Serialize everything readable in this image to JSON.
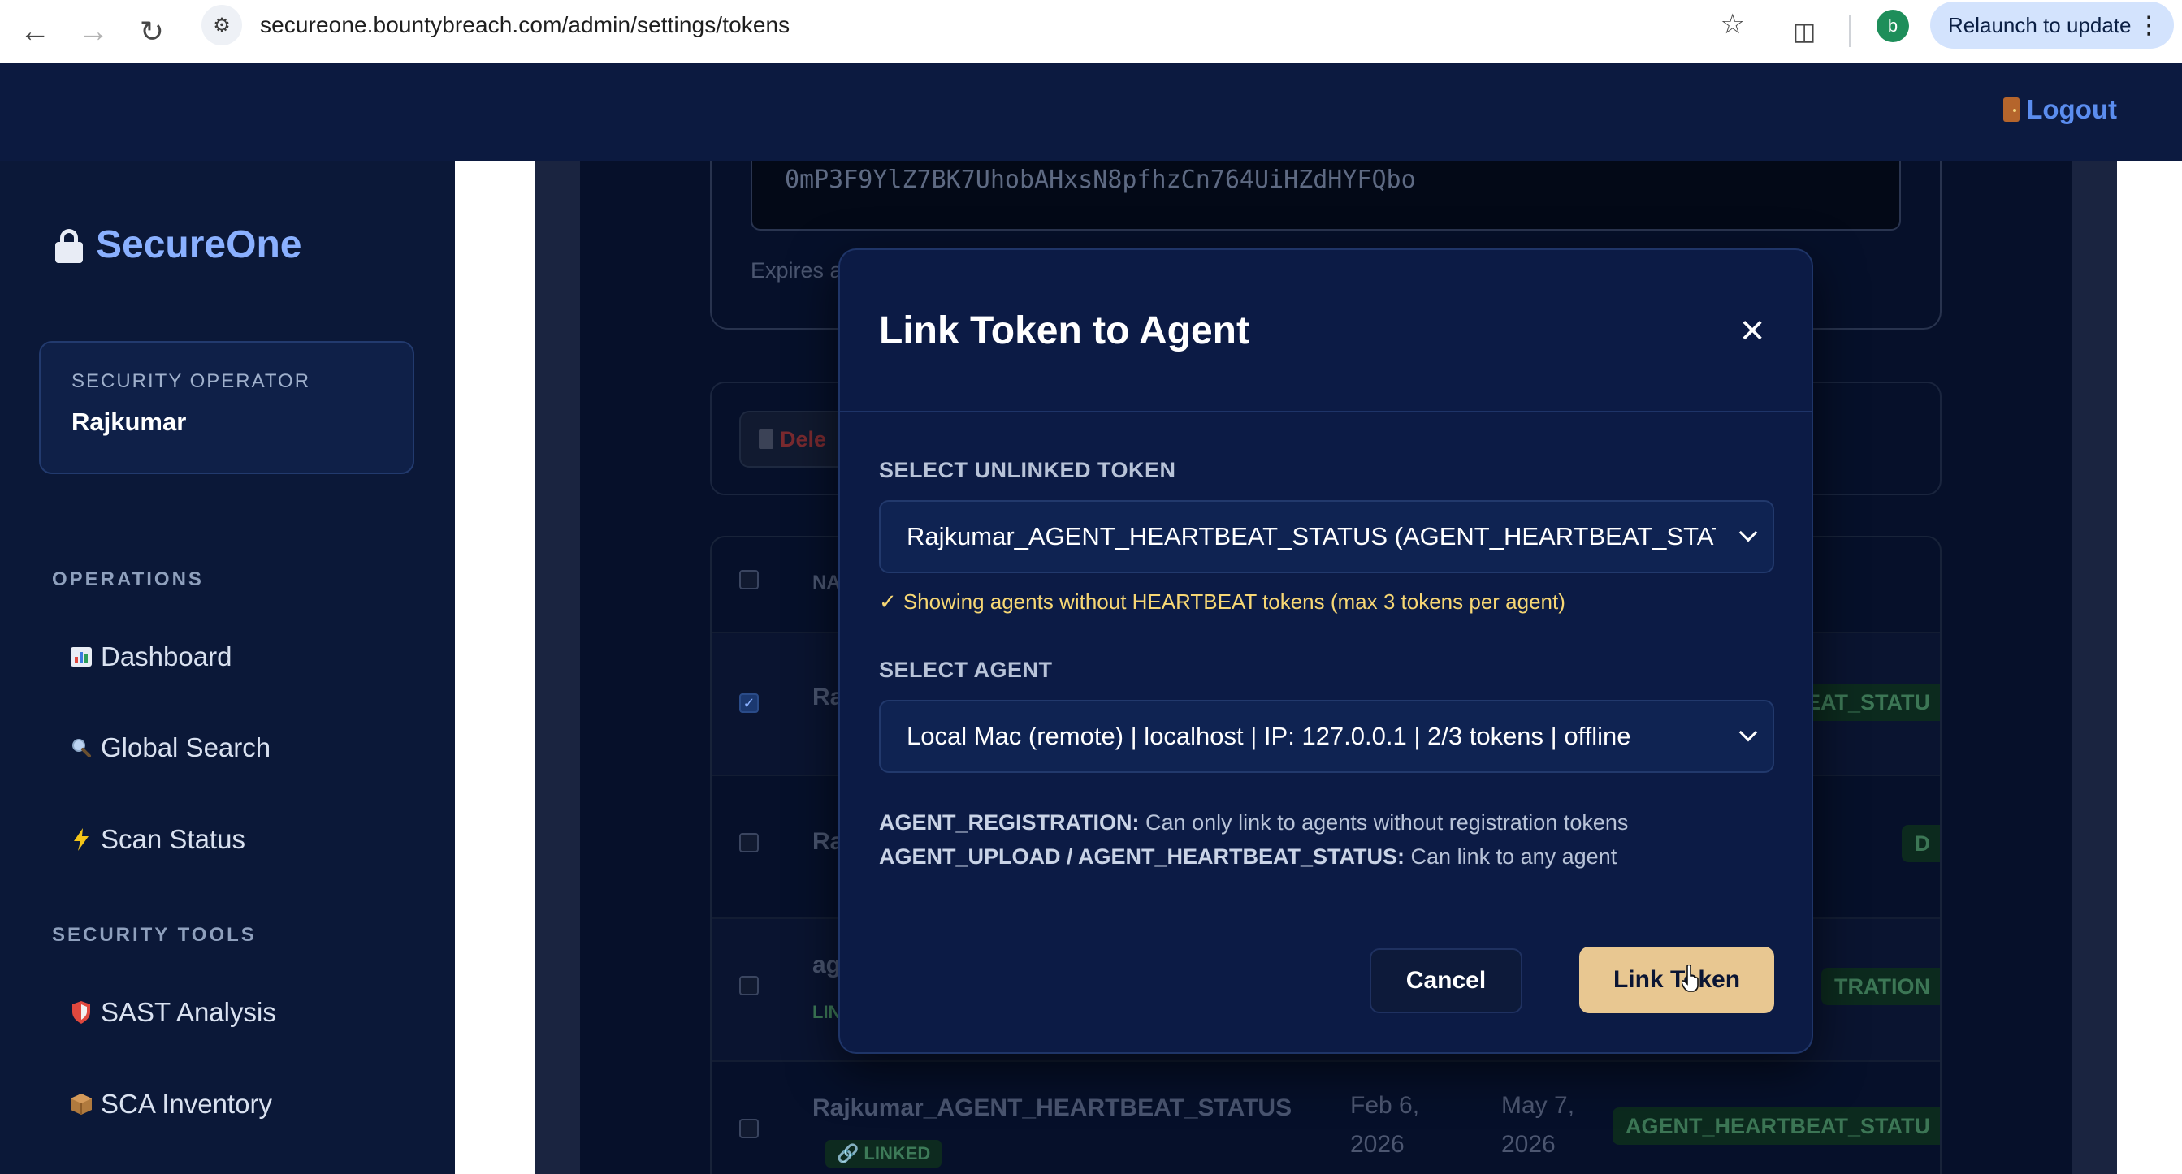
{
  "browser": {
    "url": "secureone.bountybreach.com/admin/settings/tokens",
    "relaunch_label": "Relaunch to update",
    "profile_initial": "b"
  },
  "header": {
    "logout_label": "Logout"
  },
  "sidebar": {
    "brand": "SecureOne",
    "operator_role": "SECURITY OPERATOR",
    "operator_name": "Rajkumar",
    "sections": [
      {
        "label": "OPERATIONS"
      },
      {
        "label": "SECURITY TOOLS"
      }
    ],
    "items": [
      {
        "label": "Dashboard",
        "icon": "bar-chart-icon"
      },
      {
        "label": "Global Search",
        "icon": "magnifier-icon"
      },
      {
        "label": "Scan Status",
        "icon": "lightning-icon"
      },
      {
        "label": "SAST Analysis",
        "icon": "shield-icon"
      },
      {
        "label": "SCA Inventory",
        "icon": "package-icon"
      }
    ]
  },
  "background": {
    "token_value": "0mP3F9YlZ7BK7UhobAHxsN8pfhzCn764UiHZdHYFQbo",
    "expires_prefix": "Expires a",
    "delete_label": "Dele",
    "table_header_name": "NA",
    "rows": [
      {
        "name": "Ra",
        "type": "BEAT_STATU"
      },
      {
        "name": "Ra",
        "type": "D"
      },
      {
        "name": "ag",
        "linked": "LIN",
        "type": "TRATION"
      },
      {
        "name": "Rajkumar_AGENT_HEARTBEAT_STATUS",
        "linked": "LINKED",
        "created": "Feb 6,",
        "created_year": "2026",
        "expires": "May 7,",
        "expires_year": "2026",
        "type": "AGENT_HEARTBEAT_STATU"
      }
    ]
  },
  "modal": {
    "title": "Link Token to Agent",
    "token_label": "SELECT UNLINKED TOKEN",
    "token_value": "Rajkumar_AGENT_HEARTBEAT_STATUS (AGENT_HEARTBEAT_STATUS)",
    "hint_check": "✓",
    "hint_text": "Showing agents without HEARTBEAT tokens (max 3 tokens per agent)",
    "agent_label": "SELECT AGENT",
    "agent_value": "Local Mac (remote) | localhost | IP: 127.0.0.1 | 2/3 tokens | offline",
    "info1_key": "AGENT_REGISTRATION:",
    "info1_text": "Can only link to agents without registration tokens",
    "info2_key": "AGENT_UPLOAD / AGENT_HEARTBEAT_STATUS:",
    "info2_text": "Can link to any agent",
    "cancel_label": "Cancel",
    "link_label": "Link Token"
  },
  "colors": {
    "accent": "#8ab0ff",
    "primary_button": "#e8c791",
    "hint": "#f7d774",
    "modal_bg": "#0c1b45"
  }
}
